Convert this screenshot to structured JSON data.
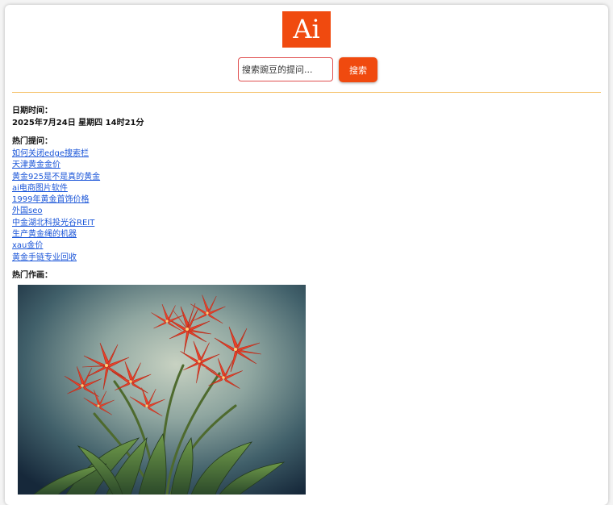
{
  "logo": {
    "text": "Ai"
  },
  "search": {
    "placeholder": "搜索豌豆的提问...",
    "button_label": "搜索"
  },
  "datetime": {
    "label": "日期时间：",
    "value": "2025年7月24日 星期四 14时21分"
  },
  "hot_questions": {
    "label": "热门提问：",
    "items": [
      "如何关闭edge搜索栏",
      "天津黄金金价",
      "黄金925是不是真的黄金",
      "ai电商图片软件",
      "1999年黄金首饰价格",
      "外国seo",
      "中金湖北科投光谷REIT",
      "生产黄金绳的机器",
      "xau金价",
      "黄金手链专业回收"
    ]
  },
  "hot_art": {
    "label": "热门作画："
  },
  "colors": {
    "accent": "#f04a0f",
    "link": "#1a55d8",
    "divider": "#f6c26b"
  }
}
